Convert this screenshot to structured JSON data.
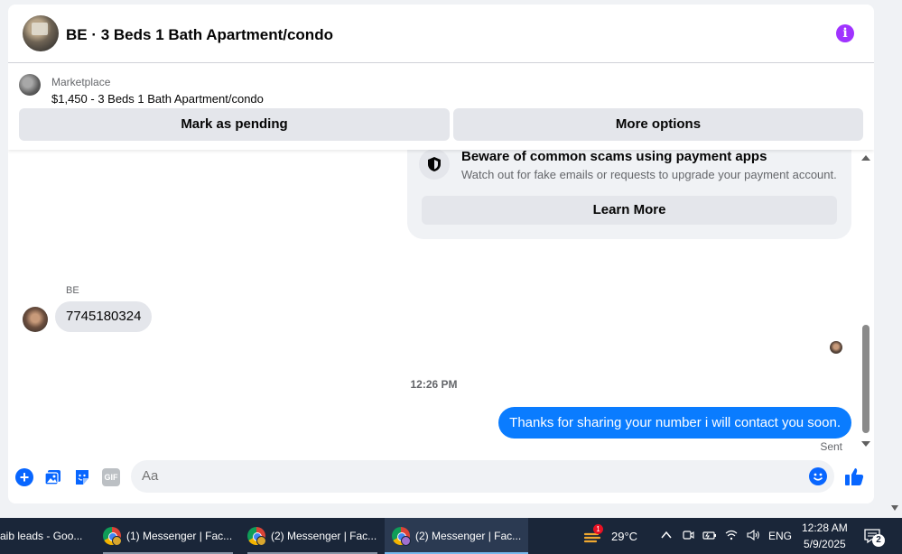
{
  "header": {
    "title": "BE · 3 Beds 1 Bath Apartment/condo"
  },
  "marketplace": {
    "label": "Marketplace",
    "listing": "$1,450 - 3 Beds 1 Bath Apartment/condo",
    "mark_pending_label": "Mark as pending",
    "more_options_label": "More options"
  },
  "scam_notice": {
    "title": "Beware of common scams using payment apps",
    "body": "Watch out for fake emails or requests to upgrade your payment account.",
    "learn_more_label": "Learn More"
  },
  "messages": {
    "sender_name": "BE",
    "incoming_text": "7745180324",
    "timestamp": "12:26 PM",
    "outgoing_text": "Thanks for sharing your number i will contact you soon.",
    "sent_status": "Sent"
  },
  "composer": {
    "placeholder": "Aa",
    "gif_label": "GIF"
  },
  "taskbar": {
    "tasks": [
      {
        "label": "aib leads - Goo..."
      },
      {
        "label": "(1) Messenger | Fac..."
      },
      {
        "label": "(2) Messenger | Fac..."
      },
      {
        "label": "(2) Messenger | Fac..."
      }
    ],
    "weather_alert_count": "1",
    "temperature": "29°C",
    "language": "ENG",
    "time": "12:28 AM",
    "date": "5/9/2025",
    "notification_count": "2"
  },
  "colors": {
    "accent_blue": "#0a7cff",
    "info_purple": "#a033ff",
    "taskbar_bg": "#1a2639"
  }
}
